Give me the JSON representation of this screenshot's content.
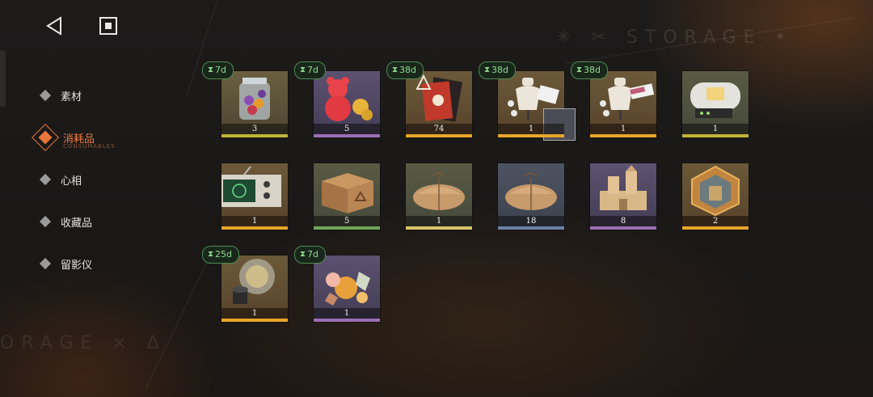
{
  "header": {
    "back_icon": "back-triangle-icon",
    "stop_icon": "stop-square-icon"
  },
  "watermarks": {
    "top": "✳ ✂ STORAGE •",
    "bottom": "ORAGE × Δ"
  },
  "sidebar": {
    "items": [
      {
        "label": "素材",
        "active": false
      },
      {
        "label": "消耗品",
        "active": true,
        "sublabel": "CONSUMABLES"
      },
      {
        "label": "心相",
        "active": false
      },
      {
        "label": "收藏品",
        "active": false
      },
      {
        "label": "留影仪",
        "active": false
      }
    ]
  },
  "inventory": {
    "items": [
      {
        "count": "3",
        "timer": "7d",
        "icon": "candy-jar-icon"
      },
      {
        "count": "5",
        "timer": "7d",
        "icon": "gummy-bear-icon"
      },
      {
        "count": "74",
        "timer": "38d",
        "icon": "ticket-pack-icon"
      },
      {
        "count": "1",
        "timer": "38d",
        "icon": "mannequin-bundle-icon"
      },
      {
        "count": "1",
        "timer": "38d",
        "icon": "mannequin-bundle-icon"
      },
      {
        "count": "1",
        "timer": "",
        "icon": "capsule-device-icon"
      },
      {
        "count": "1",
        "timer": "",
        "icon": "retro-tv-icon"
      },
      {
        "count": "5",
        "timer": "",
        "icon": "wooden-crate-icon"
      },
      {
        "count": "1",
        "timer": "",
        "icon": "parcel-icon"
      },
      {
        "count": "18",
        "timer": "",
        "icon": "parcel-icon"
      },
      {
        "count": "8",
        "timer": "",
        "icon": "sandcastle-icon"
      },
      {
        "count": "2",
        "timer": "",
        "icon": "hexagon-emblem-icon"
      },
      {
        "count": "1",
        "timer": "25d",
        "icon": "crystal-orb-icon"
      },
      {
        "count": "1",
        "timer": "7d",
        "icon": "fruit-gems-icon"
      }
    ]
  },
  "colors": {
    "accent": "#e6763b",
    "timer_text": "#8fd88f",
    "timer_border": "#4f8a55"
  }
}
